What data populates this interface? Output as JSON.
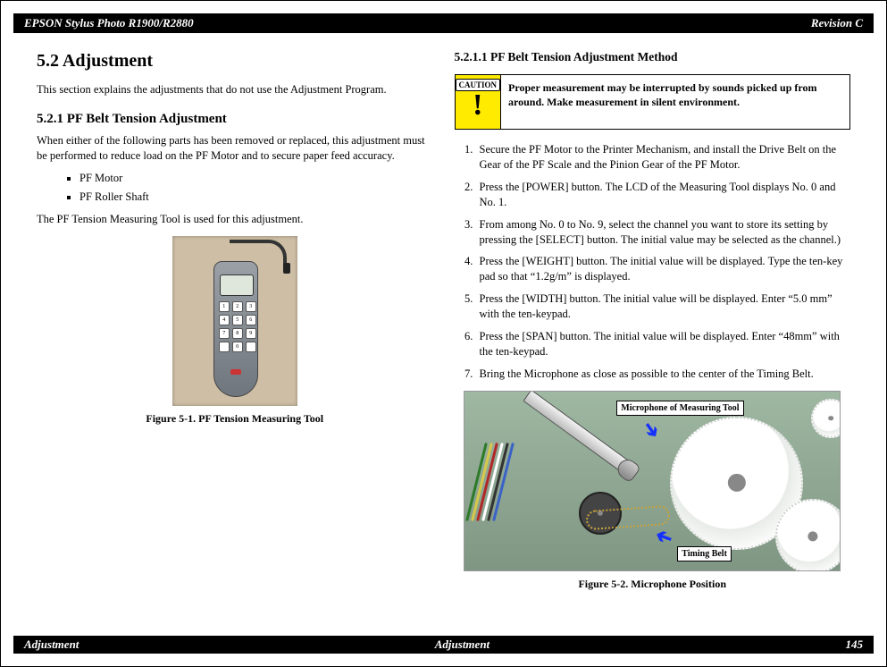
{
  "header": {
    "left": "EPSON Stylus Photo R1900/R2880",
    "right": "Revision C"
  },
  "footer": {
    "left": "Adjustment",
    "center": "Adjustment",
    "right": "145"
  },
  "left": {
    "h1": "5.2  Adjustment",
    "intro": "This section explains the adjustments that do not use the Adjustment Program.",
    "h2": "5.2.1  PF Belt Tension Adjustment",
    "para1": "When either of the following parts has been removed or replaced, this adjustment must be performed to reduce load on the PF Motor and to secure paper feed accuracy.",
    "bullets": [
      "PF Motor",
      "PF Roller Shaft"
    ],
    "para2": "The PF Tension Measuring Tool is used for this adjustment.",
    "keypad": [
      "1",
      "2",
      "3",
      "4",
      "5",
      "6",
      "7",
      "8",
      "9",
      "",
      "0",
      ""
    ],
    "figcap1": "Figure 5-1. PF Tension Measuring Tool"
  },
  "right": {
    "h3": "5.2.1.1  PF Belt Tension Adjustment Method",
    "caution_label": "CAUTION",
    "caution_text": "Proper measurement may be interrupted by sounds picked up from around. Make measurement in silent environment.",
    "steps": [
      "Secure the PF Motor to the Printer Mechanism, and install the Drive Belt on the Gear of the PF Scale and the Pinion Gear of the PF Motor.",
      "Press the [POWER] button. The LCD of the Measuring Tool displays No. 0 and No. 1.",
      "From among No. 0 to No. 9, select the channel you want to store its setting by pressing the [SELECT] button. The initial value may be selected as the channel.)",
      "Press the [WEIGHT] button. The initial value will be displayed. Type the ten-key pad so that “1.2g/m” is displayed.",
      "Press the [WIDTH] button. The initial value will be displayed. Enter “5.0 mm” with the ten-keypad.",
      "Press the [SPAN] button. The initial value will be displayed. Enter “48mm” with the ten-keypad.",
      "Bring the Microphone as close as possible to the center of the Timing Belt."
    ],
    "callout1": "Microphone of Measuring Tool",
    "callout2": "Timing Belt",
    "figcap2": "Figure 5-2. Microphone Position"
  }
}
